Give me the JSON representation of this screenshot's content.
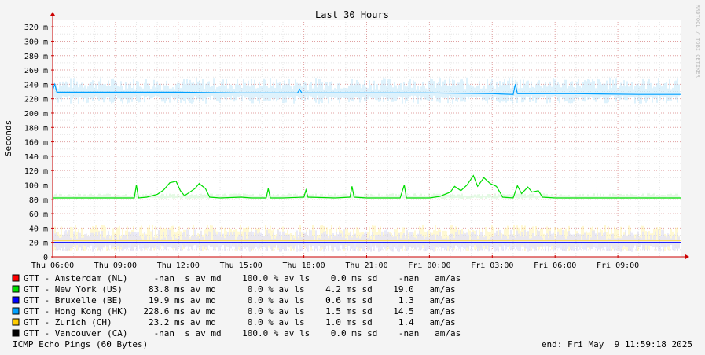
{
  "chart_data": {
    "type": "line",
    "title": "Last 30 Hours",
    "ylabel": "Seconds",
    "ylim": [
      0,
      330
    ],
    "y_ticks": [
      {
        "value": 0,
        "label": "0"
      },
      {
        "value": 20,
        "label": "20 m"
      },
      {
        "value": 40,
        "label": "40 m"
      },
      {
        "value": 60,
        "label": "60 m"
      },
      {
        "value": 80,
        "label": "80 m"
      },
      {
        "value": 100,
        "label": "100 m"
      },
      {
        "value": 120,
        "label": "120 m"
      },
      {
        "value": 140,
        "label": "140 m"
      },
      {
        "value": 160,
        "label": "160 m"
      },
      {
        "value": 180,
        "label": "180 m"
      },
      {
        "value": 200,
        "label": "200 m"
      },
      {
        "value": 220,
        "label": "220 m"
      },
      {
        "value": 240,
        "label": "240 m"
      },
      {
        "value": 260,
        "label": "260 m"
      },
      {
        "value": 280,
        "label": "280 m"
      },
      {
        "value": 300,
        "label": "300 m"
      },
      {
        "value": 320,
        "label": "320 m"
      }
    ],
    "x_ticks": [
      {
        "hour": 0,
        "label": "Thu 06:00"
      },
      {
        "hour": 3,
        "label": "Thu 09:00"
      },
      {
        "hour": 6,
        "label": "Thu 12:00"
      },
      {
        "hour": 9,
        "label": "Thu 15:00"
      },
      {
        "hour": 12,
        "label": "Thu 18:00"
      },
      {
        "hour": 15,
        "label": "Thu 21:00"
      },
      {
        "hour": 18,
        "label": "Fri 00:00"
      },
      {
        "hour": 21,
        "label": "Fri 03:00"
      },
      {
        "hour": 24,
        "label": "Fri 06:00"
      },
      {
        "hour": 27,
        "label": "Fri 09:00"
      }
    ],
    "xlim_hours": [
      0,
      30
    ],
    "grid": true,
    "series": [
      {
        "name": "GTT - Amsterdam (NL)",
        "color": "#ff0000",
        "median": null,
        "points": []
      },
      {
        "name": "GTT - New York (US)",
        "color": "#00dd00",
        "median": 83.8,
        "points": [
          [
            0,
            82
          ],
          [
            3,
            82
          ],
          [
            3.9,
            82
          ],
          [
            4.0,
            100
          ],
          [
            4.1,
            82
          ],
          [
            4.5,
            83
          ],
          [
            5.0,
            87
          ],
          [
            5.3,
            93
          ],
          [
            5.6,
            103
          ],
          [
            5.9,
            105
          ],
          [
            6.1,
            92
          ],
          [
            6.3,
            85
          ],
          [
            6.8,
            95
          ],
          [
            7.0,
            102
          ],
          [
            7.3,
            95
          ],
          [
            7.5,
            83
          ],
          [
            8.0,
            82
          ],
          [
            9.0,
            83
          ],
          [
            9.5,
            82
          ],
          [
            10.0,
            82
          ],
          [
            10.2,
            82
          ],
          [
            10.3,
            95
          ],
          [
            10.4,
            82
          ],
          [
            11,
            82
          ],
          [
            12,
            83
          ],
          [
            12.1,
            93
          ],
          [
            12.2,
            83
          ],
          [
            13.5,
            82
          ],
          [
            14.2,
            83
          ],
          [
            14.3,
            98
          ],
          [
            14.4,
            83
          ],
          [
            15,
            82
          ],
          [
            16.6,
            82
          ],
          [
            16.8,
            100
          ],
          [
            16.9,
            82
          ],
          [
            18,
            82
          ],
          [
            18.5,
            84
          ],
          [
            19.0,
            90
          ],
          [
            19.2,
            98
          ],
          [
            19.5,
            92
          ],
          [
            19.8,
            100
          ],
          [
            20.1,
            113
          ],
          [
            20.3,
            98
          ],
          [
            20.6,
            110
          ],
          [
            20.9,
            102
          ],
          [
            21.2,
            98
          ],
          [
            21.5,
            83
          ],
          [
            22.0,
            82
          ],
          [
            22.2,
            99
          ],
          [
            22.4,
            88
          ],
          [
            22.7,
            97
          ],
          [
            22.9,
            90
          ],
          [
            23.2,
            92
          ],
          [
            23.4,
            83
          ],
          [
            24,
            82
          ],
          [
            26,
            82
          ],
          [
            28,
            82
          ],
          [
            30,
            82
          ]
        ]
      },
      {
        "name": "GTT - Bruxelle (BE)",
        "color": "#0000ff",
        "median": 19.9,
        "points": [
          [
            0,
            20
          ],
          [
            5,
            20
          ],
          [
            10,
            20
          ],
          [
            15,
            20
          ],
          [
            20,
            20
          ],
          [
            25,
            20
          ],
          [
            30,
            20
          ]
        ]
      },
      {
        "name": "GTT - Hong Kong (HK)",
        "color": "#00a0ff",
        "median": 228.6,
        "points": [
          [
            0,
            232
          ],
          [
            0.1,
            240
          ],
          [
            0.2,
            229
          ],
          [
            3,
            229
          ],
          [
            6,
            229
          ],
          [
            9,
            228
          ],
          [
            11.7,
            228
          ],
          [
            11.8,
            233
          ],
          [
            11.9,
            228
          ],
          [
            14,
            228
          ],
          [
            18,
            228
          ],
          [
            21,
            227
          ],
          [
            22,
            226
          ],
          [
            22.1,
            240
          ],
          [
            22.2,
            227
          ],
          [
            25,
            227
          ],
          [
            28,
            226
          ],
          [
            30,
            226
          ]
        ]
      },
      {
        "name": "GTT - Zurich (CH)",
        "color": "#ffcc00",
        "median": 23.2,
        "points": [
          [
            0,
            23
          ],
          [
            10,
            23
          ],
          [
            20,
            23
          ],
          [
            30,
            23
          ]
        ]
      },
      {
        "name": "GTT - Vancouver (CA)",
        "color": "#000000",
        "median": null,
        "points": []
      }
    ]
  },
  "watermark": "RRDTOOL / TOBI OETIKER",
  "legend": [
    {
      "color": "#ff0000",
      "text": "GTT - Amsterdam (NL)     -nan  s av md    100.0 % av ls    0.0 ms sd    -nan   am/as"
    },
    {
      "color": "#00dd00",
      "text": "GTT - New York (US)     83.8 ms av md      0.0 % av ls    4.2 ms sd    19.0   am/as"
    },
    {
      "color": "#0000ff",
      "text": "GTT - Bruxelle (BE)     19.9 ms av md      0.0 % av ls    0.6 ms sd     1.3   am/as"
    },
    {
      "color": "#00a0ff",
      "text": "GTT - Hong Kong (HK)   228.6 ms av md      0.0 % av ls    1.5 ms sd    14.5   am/as"
    },
    {
      "color": "#ffcc00",
      "text": "GTT - Zurich (CH)       23.2 ms av md      0.0 % av ls    1.0 ms sd     1.4   am/as"
    },
    {
      "color": "#000000",
      "text": "GTT - Vancouver (CA)     -nan  s av md    100.0 % av ls    0.0 ms sd    -nan   am/as"
    }
  ],
  "footer": {
    "left": "ICMP Echo Pings (60 Bytes)",
    "right": "end: Fri May  9 11:59:18 2025"
  }
}
